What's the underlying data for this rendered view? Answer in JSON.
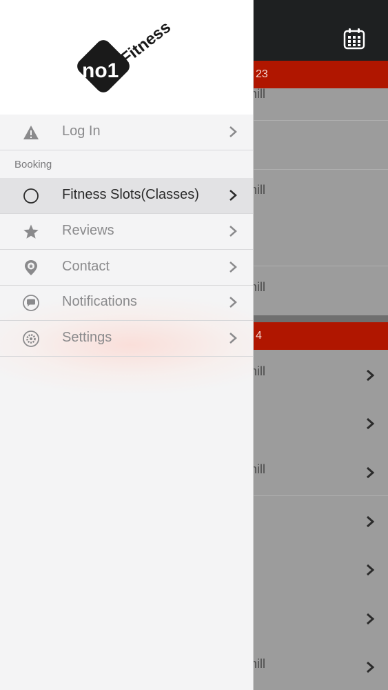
{
  "background": {
    "header1": "23",
    "header2": "4",
    "row_fragment": "mill"
  },
  "drawer": {
    "section": "Booking",
    "items": [
      {
        "label": "Log In",
        "icon": "warning-icon"
      },
      {
        "label": "Fitness Slots(Classes)",
        "icon": "circle-icon",
        "active": true
      },
      {
        "label": "Reviews",
        "icon": "star-icon"
      },
      {
        "label": "Contact",
        "icon": "location-pin-icon"
      },
      {
        "label": "Notifications",
        "icon": "chat-bubble-icon"
      },
      {
        "label": "Settings",
        "icon": "gear-icon"
      }
    ]
  },
  "logo": {
    "mark": "no1",
    "word": "Fitness"
  },
  "colors": {
    "accent": "#b01600",
    "topbar": "#1e2021",
    "logo_dot": "#d21f1f"
  }
}
